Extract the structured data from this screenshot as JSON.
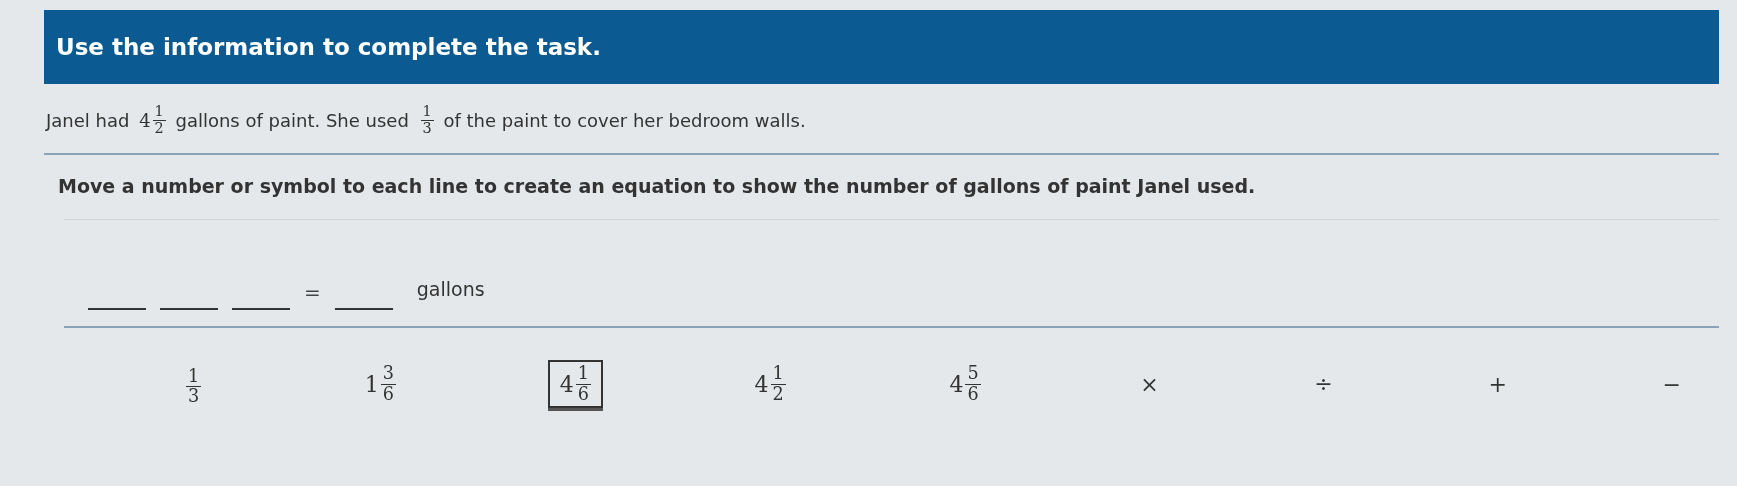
{
  "header": {
    "title": "Use the information to complete the task."
  },
  "problem": [
    {
      "kind": "text",
      "text": "Janel had "
    },
    {
      "kind": "fraction",
      "whole": "4",
      "numerator": "1",
      "denominator": "2"
    },
    {
      "kind": "text",
      "text": " gallons of paint. She used "
    },
    {
      "kind": "fraction",
      "numerator": "1",
      "denominator": "3"
    },
    {
      "kind": "text",
      "text": " of the paint to cover her bedroom walls."
    }
  ],
  "instruction": "Move a number or symbol to each line to create an equation to show the number of gallons of paint Janel used.",
  "equation": [
    {
      "kind": "blank"
    },
    {
      "kind": "blank"
    },
    {
      "kind": "blank"
    },
    {
      "kind": "symbol",
      "text": "="
    },
    {
      "kind": "blank"
    },
    {
      "kind": "unit",
      "text": "gallons"
    }
  ],
  "tiles": [
    {
      "kind": "fraction",
      "numerator": "1",
      "denominator": "3",
      "selected": false
    },
    {
      "kind": "fraction",
      "whole": "1",
      "numerator": "3",
      "denominator": "6",
      "selected": false
    },
    {
      "kind": "fraction",
      "whole": "4",
      "numerator": "1",
      "denominator": "6",
      "selected": true
    },
    {
      "kind": "fraction",
      "whole": "4",
      "numerator": "1",
      "denominator": "2",
      "selected": false
    },
    {
      "kind": "fraction",
      "whole": "4",
      "numerator": "5",
      "denominator": "6",
      "selected": false
    },
    {
      "kind": "symbol",
      "text": "×",
      "selected": false
    },
    {
      "kind": "symbol",
      "text": "÷",
      "selected": false
    },
    {
      "kind": "symbol",
      "text": "+",
      "selected": false
    },
    {
      "kind": "symbol",
      "text": "−",
      "selected": false
    }
  ]
}
